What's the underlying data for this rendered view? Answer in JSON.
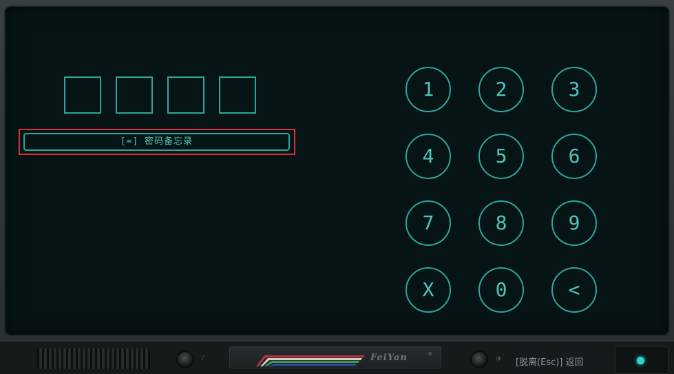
{
  "memo_button": {
    "label": "[=] 密码备忘录"
  },
  "keypad": {
    "keys": [
      "1",
      "2",
      "3",
      "4",
      "5",
      "6",
      "7",
      "8",
      "9",
      "X",
      "0",
      "<"
    ]
  },
  "footer": {
    "brand": "FeiYan",
    "registered_mark": "®",
    "esc_hint": "[脱离(Esc)] 返回"
  },
  "colors": {
    "accent": "#2ba79a",
    "highlight": "#d9303a",
    "led": "#2fd6d0"
  }
}
